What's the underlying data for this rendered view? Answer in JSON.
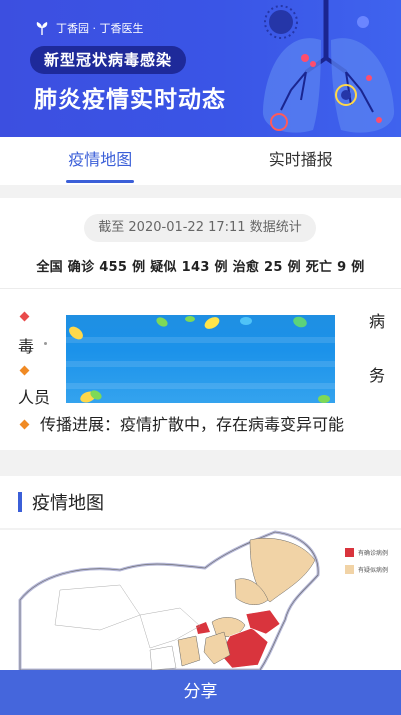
{
  "banner": {
    "brand_text": "丁香园 · 丁香医生",
    "pill_text": "新型冠状病毒感染",
    "title": "肺炎疫情实时动态"
  },
  "tabs": [
    {
      "label": "疫情地图",
      "active": true
    },
    {
      "label": "实时播报",
      "active": false
    }
  ],
  "stats": {
    "timestamp": "截至 2020-01-22 17:11 数据统计",
    "summary": "全国 确诊 455 例 疑似 143 例 治愈 25 例 死亡 9 例",
    "bullets": [
      {
        "frag_right": "病",
        "frag_left": "毒",
        "color": "#e94b4b"
      },
      {
        "frag_right": "务",
        "frag_left": "人员",
        "color": "#f08a24"
      },
      {
        "text": "传播进展：疫情扩散中，存在病毒变异可能",
        "color": "#f08a24"
      }
    ]
  },
  "map_section": {
    "title": "疫情地图",
    "legend": [
      {
        "label": "有确诊病例",
        "color": "#d9343d"
      },
      {
        "label": "有疑似病例",
        "color": "#f1d3a6"
      }
    ]
  },
  "share_label": "分享",
  "colors": {
    "accent": "#3b5fd8",
    "banner": "#3c4fe0",
    "share": "#4566dc"
  }
}
